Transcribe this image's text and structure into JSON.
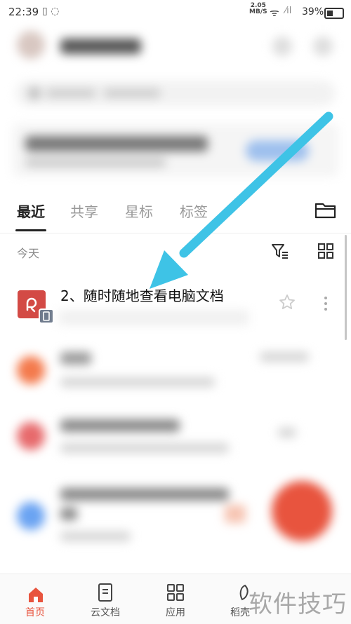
{
  "status_bar": {
    "time": "22:39",
    "net_speed_value": "2.05",
    "net_speed_unit": "MB/S",
    "battery": "39%",
    "battery_level": 0.39
  },
  "tabs": [
    {
      "label": "最近",
      "active": true
    },
    {
      "label": "共享",
      "active": false
    },
    {
      "label": "星标",
      "active": false
    },
    {
      "label": "标签",
      "active": false
    }
  ],
  "section": {
    "label": "今天"
  },
  "files": [
    {
      "title": "2、随时随地查看电脑文档"
    }
  ],
  "bottom_nav": [
    {
      "label": "首页",
      "icon": "home-icon",
      "active": true
    },
    {
      "label": "云文档",
      "icon": "cloud-doc-icon",
      "active": false
    },
    {
      "label": "应用",
      "icon": "apps-icon",
      "active": false
    },
    {
      "label": "稻壳",
      "icon": "docer-icon",
      "active": false
    }
  ],
  "watermark": "软件技巧",
  "colors": {
    "accent": "#e8543e",
    "arrow": "#3ec3e6",
    "file_icon": "#d34a45"
  }
}
